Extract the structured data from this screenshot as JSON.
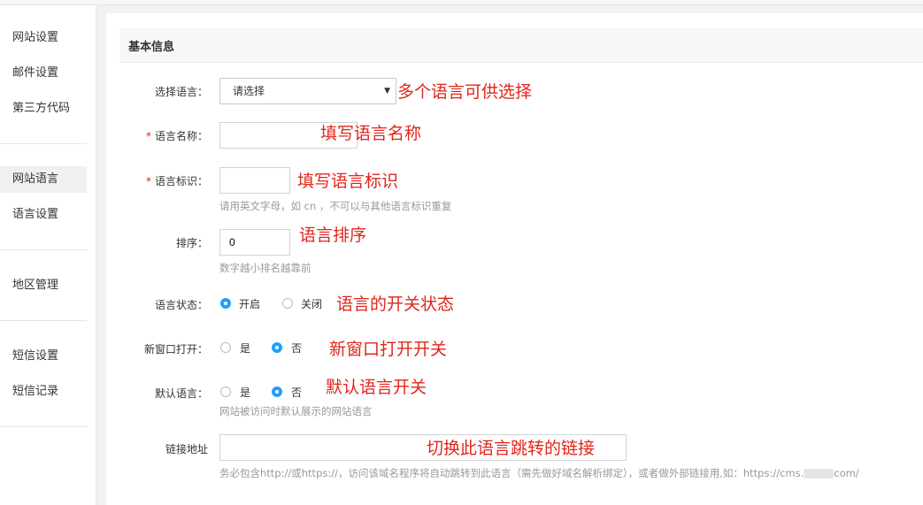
{
  "sidebar": {
    "items": [
      {
        "label": "网站设置"
      },
      {
        "label": "邮件设置"
      },
      {
        "label": "第三方代码"
      },
      {
        "label": "网站语言"
      },
      {
        "label": "语言设置"
      },
      {
        "label": "地区管理"
      },
      {
        "label": "短信设置"
      },
      {
        "label": "短信记录"
      }
    ],
    "active": "网站语言"
  },
  "section": {
    "title": "基本信息"
  },
  "form": {
    "language_select": {
      "label": "选择语言：",
      "value": "请选择",
      "annotation": "多个语言可供选择"
    },
    "language_name": {
      "label": "语言名称：",
      "value": "",
      "annotation": "填写语言名称"
    },
    "language_code": {
      "label": "语言标识：",
      "value": "",
      "hint": "请用英文字母，如 cn ，不可以与其他语言标识重复",
      "annotation": "填写语言标识"
    },
    "sort": {
      "label": "排序：",
      "value": "0",
      "hint": "数字越小排名越靠前",
      "annotation": "语言排序"
    },
    "status": {
      "label": "语言状态：",
      "options": [
        "开启",
        "关闭"
      ],
      "selected": "开启",
      "annotation": "语言的开关状态"
    },
    "new_window": {
      "label": "新窗口打开：",
      "options": [
        "是",
        "否"
      ],
      "selected": "否",
      "annotation": "新窗口打开开关"
    },
    "default_language": {
      "label": "默认语言：",
      "options": [
        "是",
        "否"
      ],
      "selected": "否",
      "hint": "网站被访问时默认展示的网站语言",
      "annotation": "默认语言开关"
    },
    "link": {
      "label": "链接地址",
      "value": "",
      "hint_prefix": "务必包含http://或https://，访问该域名程序将自动跳转到此语言（需先做好域名解析绑定），或者做外部链接用,如：https://cms.",
      "hint_suffix": "com/",
      "annotation": "切换此语言跳转的链接"
    }
  },
  "colors": {
    "accent": "#1e9fff",
    "annotation": "#e1251b",
    "required": "#e1251b"
  }
}
